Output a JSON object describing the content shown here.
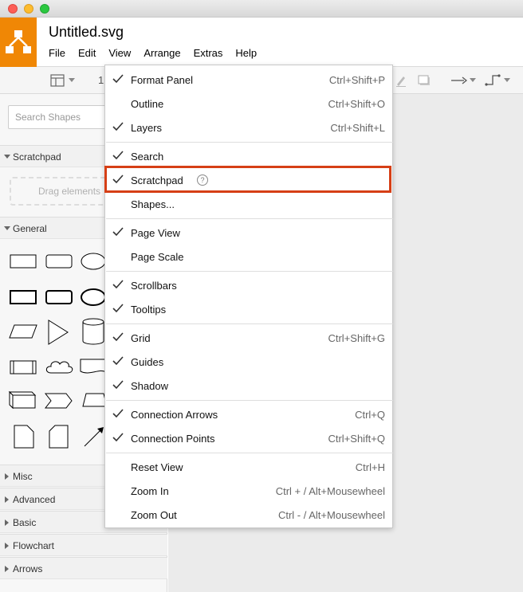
{
  "window": {
    "title": "Untitled.svg"
  },
  "menubar": [
    "File",
    "Edit",
    "View",
    "Arrange",
    "Extras",
    "Help"
  ],
  "toolbar": {
    "zoom_partial": "1"
  },
  "sidebar": {
    "search_placeholder": "Search Shapes",
    "sections": {
      "scratchpad": "Scratchpad",
      "general": "General",
      "misc": "Misc",
      "advanced": "Advanced",
      "basic": "Basic",
      "flowchart": "Flowchart",
      "arrows": "Arrows"
    },
    "drag_hint": "Drag elements"
  },
  "view_menu": {
    "items": [
      {
        "label": "Format Panel",
        "shortcut": "Ctrl+Shift+P",
        "checked": true
      },
      {
        "label": "Outline",
        "shortcut": "Ctrl+Shift+O",
        "checked": false
      },
      {
        "label": "Layers",
        "shortcut": "Ctrl+Shift+L",
        "checked": true
      },
      {
        "label": "Search",
        "shortcut": "",
        "checked": true
      },
      {
        "label": "Scratchpad",
        "shortcut": "",
        "checked": true,
        "help": "?"
      },
      {
        "label": "Shapes...",
        "shortcut": "",
        "checked": false
      },
      {
        "label": "Page View",
        "shortcut": "",
        "checked": true
      },
      {
        "label": "Page Scale",
        "shortcut": "",
        "checked": false
      },
      {
        "label": "Scrollbars",
        "shortcut": "",
        "checked": true
      },
      {
        "label": "Tooltips",
        "shortcut": "",
        "checked": true
      },
      {
        "label": "Grid",
        "shortcut": "Ctrl+Shift+G",
        "checked": true
      },
      {
        "label": "Guides",
        "shortcut": "",
        "checked": true
      },
      {
        "label": "Shadow",
        "shortcut": "",
        "checked": true
      },
      {
        "label": "Connection Arrows",
        "shortcut": "Ctrl+Q",
        "checked": true
      },
      {
        "label": "Connection Points",
        "shortcut": "Ctrl+Shift+Q",
        "checked": true
      },
      {
        "label": "Reset View",
        "shortcut": "Ctrl+H",
        "checked": false
      },
      {
        "label": "Zoom In",
        "shortcut": "Ctrl + / Alt+Mousewheel",
        "checked": false
      },
      {
        "label": "Zoom Out",
        "shortcut": "Ctrl - / Alt+Mousewheel",
        "checked": false
      }
    ]
  },
  "colors": {
    "brand": "#f08705",
    "highlight": "#d63f16"
  }
}
